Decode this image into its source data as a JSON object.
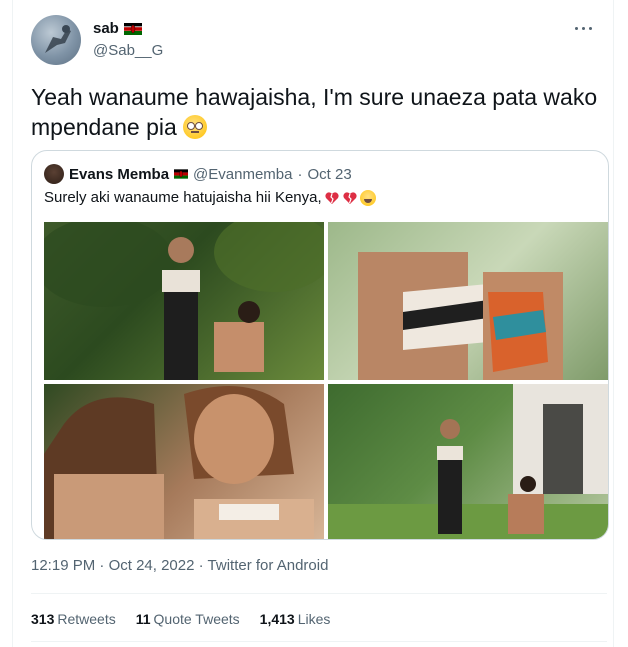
{
  "author": {
    "name": "sab",
    "handle": "@Sab__G",
    "flag": "kenya-flag-icon"
  },
  "tweet": {
    "text": "Yeah wanaume hawajaisha, I'm sure unaeza pata wako mpendane pia",
    "emoji": "rolling-eyes-emoji"
  },
  "quoted": {
    "name": "Evans Memba",
    "handle": "@Evanmemba",
    "separator": "·",
    "date": "Oct 23",
    "text": "Surely aki wanaume hatujaisha hii Kenya,",
    "emojis": [
      "broken-heart-emoji",
      "broken-heart-emoji",
      "tears-of-joy-emoji"
    ]
  },
  "meta": {
    "time": "12:19 PM",
    "separator": "·",
    "date": "Oct 24, 2022",
    "source": "Twitter for Android"
  },
  "stats": {
    "retweets_count": "313",
    "retweets_label": "Retweets",
    "quotes_count": "11",
    "quotes_label": "Quote Tweets",
    "likes_count": "1,413",
    "likes_label": "Likes"
  },
  "colors": {
    "text": "#0f1419",
    "secondary": "#536471",
    "border": "#cfd9de",
    "divider": "#eff3f4"
  }
}
